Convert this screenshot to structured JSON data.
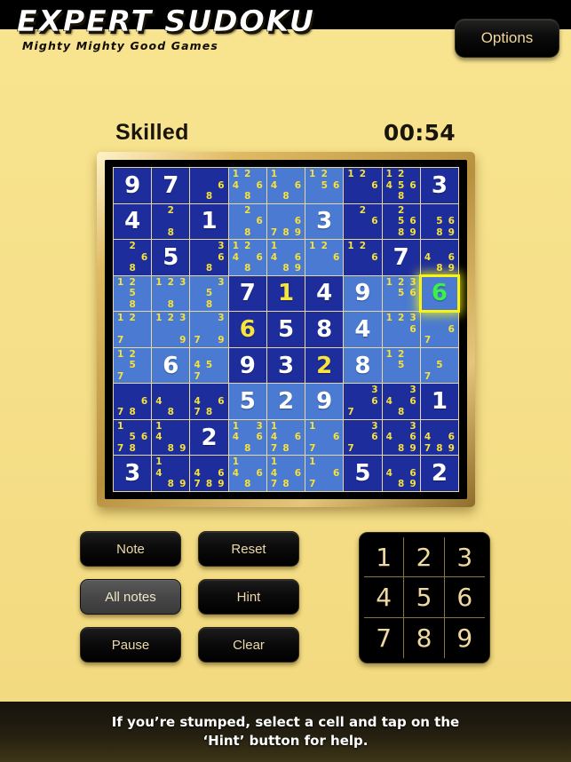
{
  "app": {
    "title": "EXPERT SUDOKU",
    "subtitle": "Mighty Mighty Good Games",
    "options_label": "Options"
  },
  "status": {
    "difficulty": "Skilled",
    "timer": "00:54"
  },
  "colors": {
    "page_background": "#f6e08a",
    "header_background": "#000000",
    "cell_dark": "#1d2d9c",
    "cell_light": "#4a7ad1",
    "given_value": "#ffffff",
    "entered_value": "#f7e53c",
    "selected_value": "#3bf04a",
    "selection_outline": "#f9f411",
    "note_text": "#f6e23a",
    "grid_line": "#e8d79a",
    "button_text": "#ecd9a8"
  },
  "board": {
    "selected_cell": {
      "row": 4,
      "col": 9
    },
    "cells": [
      [
        {
          "value": "9",
          "kind": "given",
          "notes": []
        },
        {
          "value": "7",
          "kind": "given",
          "notes": []
        },
        {
          "value": "",
          "kind": "empty",
          "notes": [
            6,
            8
          ]
        },
        {
          "value": "",
          "kind": "empty",
          "notes": [
            1,
            2,
            4,
            6,
            8
          ]
        },
        {
          "value": "",
          "kind": "empty",
          "notes": [
            1,
            4,
            6,
            8
          ]
        },
        {
          "value": "",
          "kind": "empty",
          "notes": [
            1,
            2,
            5,
            6
          ]
        },
        {
          "value": "",
          "kind": "empty",
          "notes": [
            1,
            2,
            6
          ]
        },
        {
          "value": "",
          "kind": "empty",
          "notes": [
            1,
            2,
            4,
            5,
            6,
            8
          ]
        },
        {
          "value": "3",
          "kind": "given",
          "notes": []
        }
      ],
      [
        {
          "value": "4",
          "kind": "given",
          "notes": []
        },
        {
          "value": "",
          "kind": "empty",
          "notes": [
            2,
            8
          ]
        },
        {
          "value": "1",
          "kind": "given",
          "notes": []
        },
        {
          "value": "",
          "kind": "empty",
          "notes": [
            2,
            6,
            8
          ]
        },
        {
          "value": "",
          "kind": "empty",
          "notes": [
            6,
            7,
            8,
            9
          ]
        },
        {
          "value": "3",
          "kind": "given",
          "notes": []
        },
        {
          "value": "",
          "kind": "empty",
          "notes": [
            2,
            6
          ]
        },
        {
          "value": "",
          "kind": "empty",
          "notes": [
            2,
            5,
            6,
            8,
            9
          ]
        },
        {
          "value": "",
          "kind": "empty",
          "notes": [
            5,
            6,
            8,
            9
          ]
        }
      ],
      [
        {
          "value": "",
          "kind": "empty",
          "notes": [
            2,
            6,
            8
          ]
        },
        {
          "value": "5",
          "kind": "given",
          "notes": []
        },
        {
          "value": "",
          "kind": "empty",
          "notes": [
            3,
            6,
            8
          ]
        },
        {
          "value": "",
          "kind": "empty",
          "notes": [
            1,
            2,
            4,
            6,
            8
          ]
        },
        {
          "value": "",
          "kind": "empty",
          "notes": [
            1,
            4,
            6,
            8,
            9
          ]
        },
        {
          "value": "",
          "kind": "empty",
          "notes": [
            1,
            2,
            6
          ]
        },
        {
          "value": "",
          "kind": "empty",
          "notes": [
            1,
            2,
            6
          ]
        },
        {
          "value": "7",
          "kind": "given",
          "notes": []
        },
        {
          "value": "",
          "kind": "empty",
          "notes": [
            4,
            6,
            8,
            9
          ]
        }
      ],
      [
        {
          "value": "",
          "kind": "empty",
          "notes": [
            1,
            2,
            5,
            8
          ]
        },
        {
          "value": "",
          "kind": "empty",
          "notes": [
            1,
            2,
            3,
            8
          ]
        },
        {
          "value": "",
          "kind": "empty",
          "notes": [
            3,
            5,
            8
          ]
        },
        {
          "value": "7",
          "kind": "given",
          "notes": []
        },
        {
          "value": "1",
          "kind": "entered",
          "notes": []
        },
        {
          "value": "4",
          "kind": "given",
          "notes": []
        },
        {
          "value": "9",
          "kind": "given",
          "notes": []
        },
        {
          "value": "",
          "kind": "empty",
          "notes": [
            1,
            2,
            3,
            5,
            6
          ]
        },
        {
          "value": "6",
          "kind": "selected",
          "notes": []
        }
      ],
      [
        {
          "value": "",
          "kind": "empty",
          "notes": [
            1,
            2,
            7
          ]
        },
        {
          "value": "",
          "kind": "empty",
          "notes": [
            1,
            2,
            3,
            9
          ]
        },
        {
          "value": "",
          "kind": "empty",
          "notes": [
            3,
            7,
            9
          ]
        },
        {
          "value": "6",
          "kind": "entered",
          "notes": []
        },
        {
          "value": "5",
          "kind": "given",
          "notes": []
        },
        {
          "value": "8",
          "kind": "given",
          "notes": []
        },
        {
          "value": "4",
          "kind": "given",
          "notes": []
        },
        {
          "value": "",
          "kind": "empty",
          "notes": [
            1,
            2,
            3,
            6
          ]
        },
        {
          "value": "",
          "kind": "empty",
          "notes": [
            6,
            7
          ]
        }
      ],
      [
        {
          "value": "",
          "kind": "empty",
          "notes": [
            1,
            2,
            5,
            7
          ]
        },
        {
          "value": "6",
          "kind": "given",
          "notes": []
        },
        {
          "value": "",
          "kind": "empty",
          "notes": [
            4,
            5,
            7
          ]
        },
        {
          "value": "9",
          "kind": "given",
          "notes": []
        },
        {
          "value": "3",
          "kind": "given",
          "notes": []
        },
        {
          "value": "2",
          "kind": "entered",
          "notes": []
        },
        {
          "value": "8",
          "kind": "given",
          "notes": []
        },
        {
          "value": "",
          "kind": "empty",
          "notes": [
            1,
            2,
            5
          ]
        },
        {
          "value": "",
          "kind": "empty",
          "notes": [
            5,
            7
          ]
        }
      ],
      [
        {
          "value": "",
          "kind": "empty",
          "notes": [
            6,
            7,
            8
          ]
        },
        {
          "value": "",
          "kind": "empty",
          "notes": [
            4,
            8
          ]
        },
        {
          "value": "",
          "kind": "empty",
          "notes": [
            4,
            6,
            7,
            8
          ]
        },
        {
          "value": "5",
          "kind": "given",
          "notes": []
        },
        {
          "value": "2",
          "kind": "given",
          "notes": []
        },
        {
          "value": "9",
          "kind": "given",
          "notes": []
        },
        {
          "value": "",
          "kind": "empty",
          "notes": [
            3,
            6,
            7
          ]
        },
        {
          "value": "",
          "kind": "empty",
          "notes": [
            3,
            4,
            6,
            8
          ]
        },
        {
          "value": "1",
          "kind": "given",
          "notes": []
        }
      ],
      [
        {
          "value": "",
          "kind": "empty",
          "notes": [
            1,
            5,
            6,
            7,
            8
          ]
        },
        {
          "value": "",
          "kind": "empty",
          "notes": [
            1,
            4,
            8,
            9
          ]
        },
        {
          "value": "2",
          "kind": "given",
          "notes": []
        },
        {
          "value": "",
          "kind": "empty",
          "notes": [
            1,
            3,
            4,
            6,
            8
          ]
        },
        {
          "value": "",
          "kind": "empty",
          "notes": [
            1,
            4,
            6,
            7,
            8
          ]
        },
        {
          "value": "",
          "kind": "empty",
          "notes": [
            1,
            6,
            7
          ]
        },
        {
          "value": "",
          "kind": "empty",
          "notes": [
            3,
            6,
            7
          ]
        },
        {
          "value": "",
          "kind": "empty",
          "notes": [
            3,
            4,
            6,
            8,
            9
          ]
        },
        {
          "value": "",
          "kind": "empty",
          "notes": [
            4,
            6,
            7,
            8,
            9
          ]
        }
      ],
      [
        {
          "value": "3",
          "kind": "given",
          "notes": []
        },
        {
          "value": "",
          "kind": "empty",
          "notes": [
            1,
            4,
            8,
            9
          ]
        },
        {
          "value": "",
          "kind": "empty",
          "notes": [
            4,
            6,
            7,
            8,
            9
          ]
        },
        {
          "value": "",
          "kind": "empty",
          "notes": [
            1,
            4,
            6,
            8
          ]
        },
        {
          "value": "",
          "kind": "empty",
          "notes": [
            1,
            4,
            6,
            7,
            8
          ]
        },
        {
          "value": "",
          "kind": "empty",
          "notes": [
            1,
            6,
            7
          ]
        },
        {
          "value": "5",
          "kind": "given",
          "notes": []
        },
        {
          "value": "",
          "kind": "empty",
          "notes": [
            4,
            6,
            8,
            9
          ]
        },
        {
          "value": "2",
          "kind": "given",
          "notes": []
        }
      ]
    ]
  },
  "controls": {
    "note": "Note",
    "all_notes": "All notes",
    "pause": "Pause",
    "reset": "Reset",
    "hint": "Hint",
    "clear": "Clear",
    "active_button": "All notes"
  },
  "numpad": {
    "keys": [
      "1",
      "2",
      "3",
      "4",
      "5",
      "6",
      "7",
      "8",
      "9"
    ]
  },
  "footer": {
    "tip": "If you’re stumped, select a cell and tap on the\n‘Hint’ button for help."
  }
}
